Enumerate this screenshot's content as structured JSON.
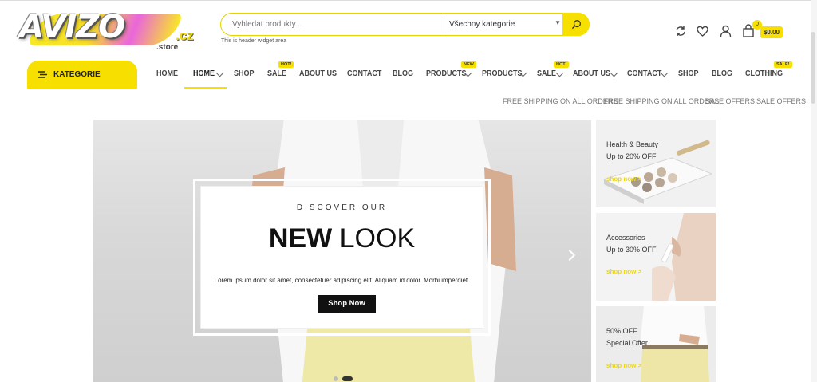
{
  "header": {
    "logo_text": "AVIZO",
    "logo_tld": ".cz",
    "logo_sub": ".store",
    "search": {
      "placeholder": "Vyhledat produkty...",
      "category_selected": "Všechny kategorie"
    },
    "widget_note": "This is header widget area",
    "cart": {
      "count": "0",
      "total": "$0.00"
    },
    "icons": [
      "refresh-icon",
      "heart-icon",
      "user-icon",
      "cart-icon"
    ]
  },
  "nav": {
    "kategorie_label": "KATEGORIE",
    "items": [
      {
        "label": "HOME",
        "badge": ""
      },
      {
        "label": "HOME",
        "badge": ""
      },
      {
        "label": "SHOP",
        "badge": ""
      },
      {
        "label": "SALE",
        "badge": "HOT!"
      },
      {
        "label": "ABOUT US",
        "badge": ""
      },
      {
        "label": "CONTACT",
        "badge": ""
      },
      {
        "label": "BLOG",
        "badge": ""
      },
      {
        "label": "PRODUCTS",
        "badge": "NEW"
      },
      {
        "label": "PRODUCTS",
        "badge": ""
      },
      {
        "label": "SALE",
        "badge": "HOT!"
      },
      {
        "label": "ABOUT US",
        "badge": ""
      },
      {
        "label": "CONTACT",
        "badge": ""
      },
      {
        "label": "SHOP",
        "badge": ""
      },
      {
        "label": "BLOG",
        "badge": ""
      },
      {
        "label": "CLOTHING",
        "badge": "SALE!"
      }
    ],
    "promos": [
      "FREE SHIPPING ON ALL ORDERS",
      "FREE SHIPPING ON ALL ORDERS",
      "SALE OFFERS",
      "SALE OFFERS"
    ]
  },
  "hero": {
    "kicker": "DISCOVER OUR",
    "title_bold": "NEW",
    "title_thin": "LOOK",
    "text": "Lorem ipsum dolor sit amet, consectetuer adipiscing elit. Aliquam id dolor. Morbi imperdiet.",
    "button": "Shop Now"
  },
  "side_banners": [
    {
      "line1": "Health & Beauty",
      "line2": "Up to 20% OFF",
      "link": "shop now >"
    },
    {
      "line1": "Accessories",
      "line2": "Up to 30% OFF",
      "link": "shop now >"
    },
    {
      "line1": "50% OFF",
      "line2": "Special Offer",
      "link": "shop now >"
    }
  ],
  "colors": {
    "accent": "#f7e000",
    "text": "#333333"
  }
}
